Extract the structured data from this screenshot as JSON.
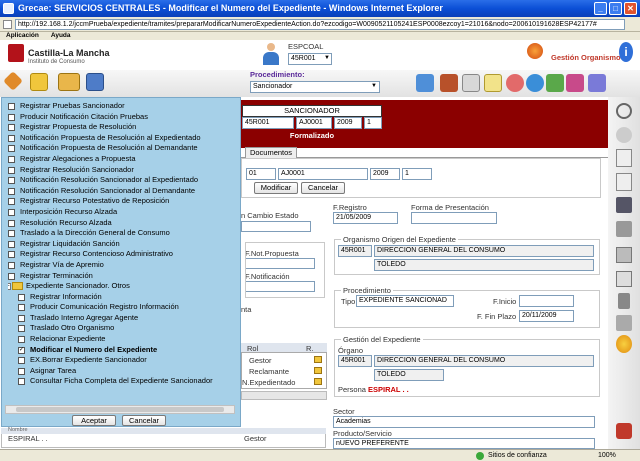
{
  "window": {
    "title": "Grecae: SERVICIOS CENTRALES - Modificar el Numero del Expediente - Windows Internet Explorer",
    "url": "http://192.168.1.2/jccmPrueba/expediente/tramites/prepararModificarNumeroExpedienteAction.do?ezcodigo=W0090521105241ESP0008ezcoy1=21016&nodo=200610191628ESP42177#"
  },
  "menu": {
    "items": [
      "Aplicación",
      "Ayuda"
    ]
  },
  "header": {
    "logo_title": "Castilla-La Mancha",
    "logo_subtitle": "Instituto de Consumo",
    "user_code": "ESPCOAL",
    "office_select": "45R001",
    "gestion_label": "Gestión Organismo"
  },
  "toolbar": {
    "procedure_label": "Procedimiento:",
    "procedure_value": "Sancionador"
  },
  "record": {
    "type_label": "SANCIONADOR",
    "code1": "45R001",
    "code2": "AJ0001",
    "year": "2009",
    "num": "1",
    "status": "Formalizado"
  },
  "tabs": {
    "documents": "Documentos"
  },
  "edit": {
    "f1": "01",
    "f2": "AJ0001",
    "f3": "2009",
    "f4": "1",
    "modify_btn": "Modificar",
    "cancel_btn": "Cancelar"
  },
  "form": {
    "cambio_estado": "n Cambio Estado",
    "registro_label": "F.Registro",
    "registro_value": "21/05/2009",
    "presentacion_label": "Forma de Presentación",
    "propuesta_label": "F.Not.Propuesta",
    "notificacion_label": "F.Notificación",
    "nta_label": "nta",
    "origen_legend": "Organismo Origen del Expediente",
    "origen_code": "45R001",
    "origen_name": "DIRECCION GENERAL DEL CONSUMO",
    "origen_city": "TOLEDO",
    "proc_legend": "Procedimiento",
    "tipo_label": "Tipo",
    "tipo_value": "EXPEDIENTE SANCIONAD",
    "inicio_label": "F.Inicio",
    "plazo_label": "F. Fin Plazo",
    "plazo_value": "20/11/2009",
    "gestion_legend": "Gestión del Expediente",
    "organo_label": "Órgano",
    "organo_code": "45R001",
    "organo_name": "DIRECCION GENERAL DEL CONSUMO",
    "organo_city": "TOLEDO",
    "persona_label": "Persona",
    "persona_value": "ESPIRAL . .",
    "sector_label": "Sector",
    "sector_value": "Academias",
    "producto_label": "Producto/Servicio",
    "producto_value": "nUEVO PREFERENTE"
  },
  "roles": {
    "header_rol": "Rol",
    "header_r": "R.",
    "rows": [
      "Gestor",
      "Reclamante",
      "N.Expedientado"
    ],
    "bottom_name": "ESPIRAL . .",
    "bottom_role": "Gestor",
    "nombre_label": "Nombre"
  },
  "tree_panel": {
    "items": [
      "Registrar Pruebas Sancionador",
      "Producir Notificación Citación Pruebas",
      "Registrar Propuesta de Resolución",
      "Notificación Propuesta de Resolución al Expedientado",
      "Notificación Propuesta de Resolución al Demandante",
      "Registrar Alegaciones a Propuesta",
      "Registrar Resolución Sancionador",
      "Notificación Resolución Sancionador al Expedientado",
      "Notificación Resolución Sancionador al Demandante",
      "Registrar Recurso Potestativo de Reposición",
      "Interposición Recurso Alzada",
      "Resolución Recurso Alzada",
      "Traslado a la Dirección General de Consumo",
      "Registrar Liquidación Sanción",
      "Registrar Recurso Contencioso Administrativo",
      "Registrar Vía de Apremio",
      "Registrar Terminación"
    ],
    "group_label": "Expediente Sancionador. Otros",
    "children": [
      "Registrar Información",
      "Producir Comunicación Registro Información",
      "Traslado Interno Agregar Agente",
      "Traslado Otro Organismo",
      "Relacionar Expediente",
      "Modificar el Numero del Expediente",
      "EX.Borrar Expediente Sancionador",
      "Asignar Tarea",
      "Consultar Ficha Completa del Expediente Sancionador"
    ],
    "checked_child": "Modificar el Numero del Expediente",
    "accept_btn": "Aceptar",
    "cancel_btn": "Cancelar"
  },
  "status": {
    "zone": "Sitios de confianza",
    "zoom": "100%"
  },
  "colors": {
    "accent": "#8b0000",
    "brand_blue": "#0b4fd6",
    "panel": "#a6d0e8"
  }
}
